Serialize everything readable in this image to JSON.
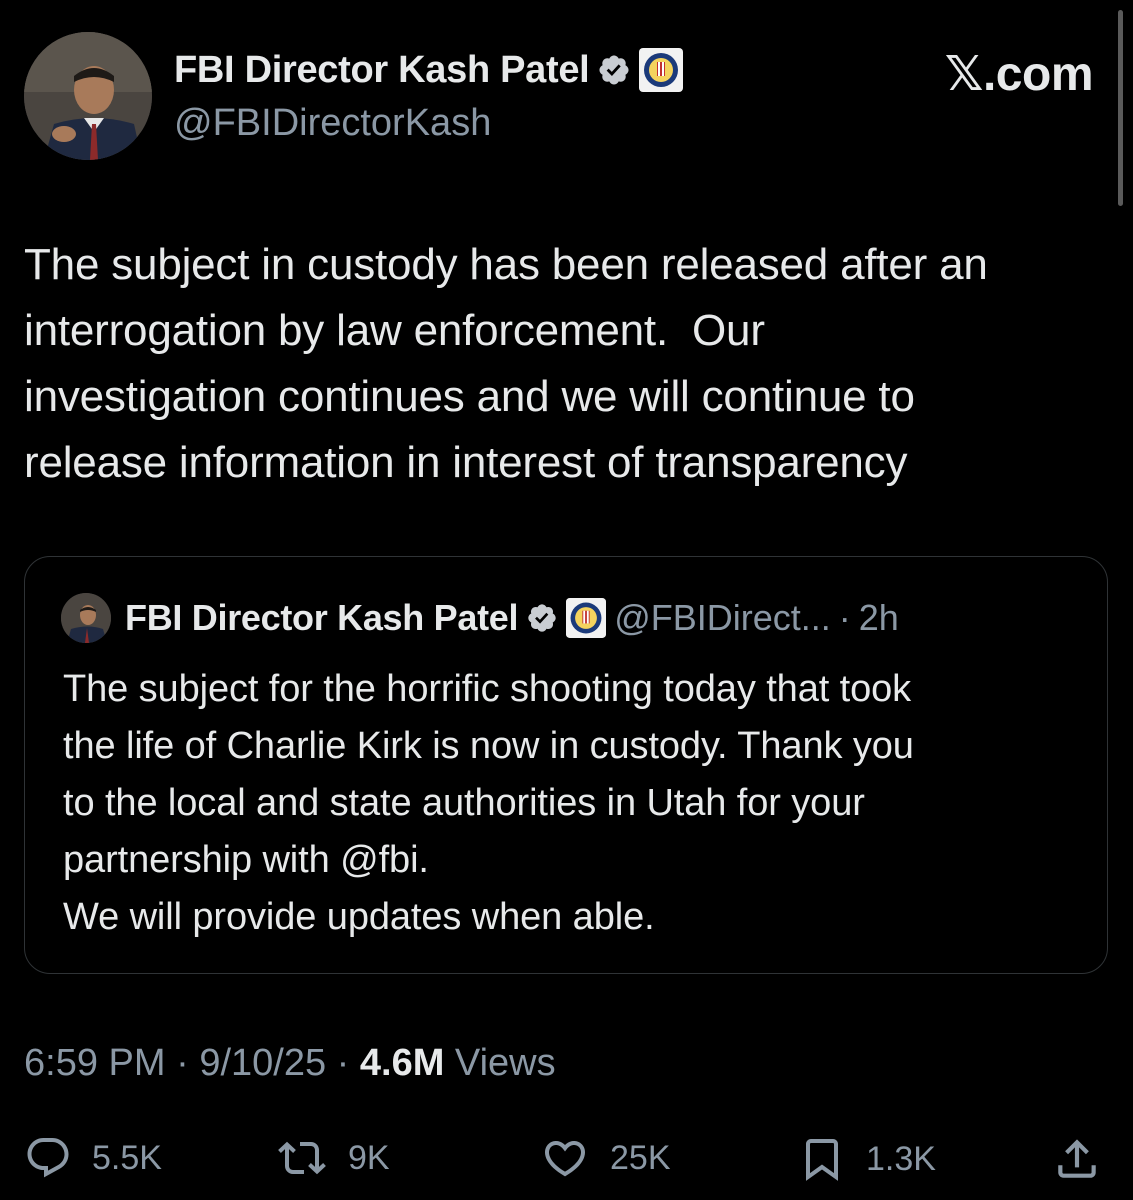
{
  "author": {
    "display_name": "FBI Director Kash Patel",
    "handle": "@FBIDirectorKash"
  },
  "site_logo": "𝕏.com",
  "tweet": {
    "text": "The subject in custody has been released after an\ninterrogation by law enforcement.  Our\ninvestigation continues and we will continue to\nrelease information in interest of transparency"
  },
  "quoted_tweet": {
    "display_name": "FBI Director Kash Patel",
    "handle": "@FBIDirect...",
    "separator": "·",
    "time": "2h",
    "text": "The subject for the horrific shooting today that took\nthe life of Charlie Kirk is now in custody. Thank you\nto the local and state authorities in Utah for your\npartnership with @fbi.\nWe will provide updates when able."
  },
  "meta": {
    "time": "6:59 PM",
    "sep1": " · ",
    "date": "9/10/25",
    "sep2": " · ",
    "views_count": "4.6M",
    "views_label": " Views"
  },
  "actions": {
    "replies": "5.5K",
    "reposts": "9K",
    "likes": "25K",
    "bookmarks": "1.3K"
  },
  "icons": {
    "verified": "verified-badge-icon",
    "affiliate": "fbi-seal-icon",
    "reply": "reply-icon",
    "repost": "repost-icon",
    "like": "heart-icon",
    "bookmark": "bookmark-icon",
    "share": "share-icon"
  },
  "colors": {
    "background": "#000000",
    "text": "#e7e9ea",
    "secondary_text": "#8b98a5",
    "border": "#2f3336",
    "verified_blue": "#1d9bf0"
  }
}
